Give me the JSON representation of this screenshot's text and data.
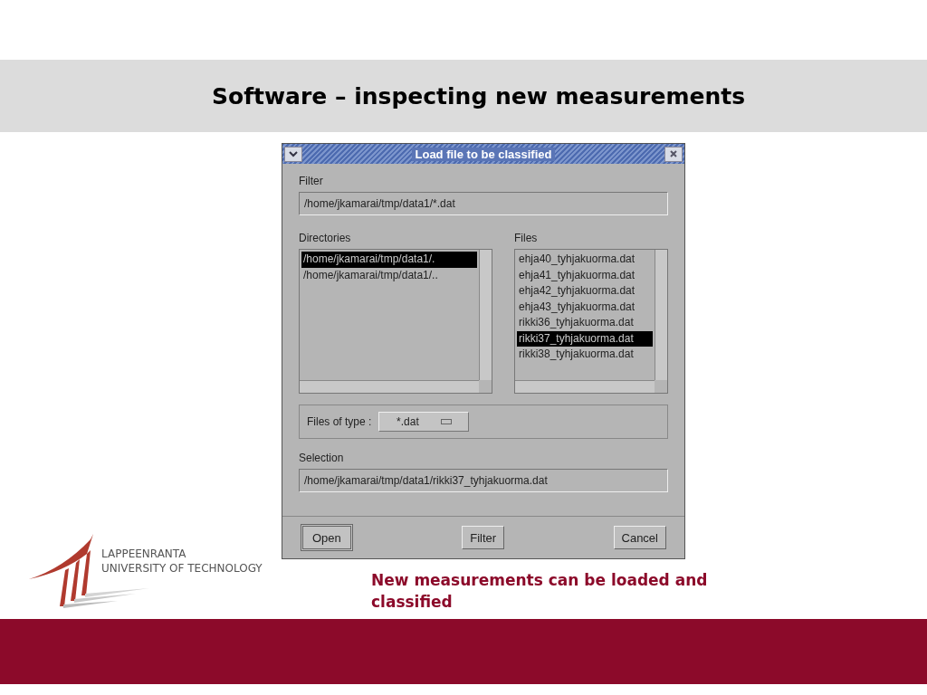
{
  "slide": {
    "title": "Software – inspecting new measurements",
    "caption": "New measurements can be loaded and classified"
  },
  "logo": {
    "lines": [
      "LAPPEENRANTA",
      "UNIVERSITY OF TECHNOLOGY"
    ]
  },
  "dialog": {
    "title": "Load file to be classified",
    "filter": {
      "label": "Filter",
      "value": "/home/jkamarai/tmp/data1/*.dat"
    },
    "directories": {
      "label": "Directories",
      "items": [
        {
          "label": "/home/jkamarai/tmp/data1/.",
          "selected": true
        },
        {
          "label": "/home/jkamarai/tmp/data1/..",
          "selected": false
        }
      ]
    },
    "files": {
      "label": "Files",
      "items": [
        {
          "label": "ehja40_tyhjakuorma.dat",
          "selected": false
        },
        {
          "label": "ehja41_tyhjakuorma.dat",
          "selected": false
        },
        {
          "label": "ehja42_tyhjakuorma.dat",
          "selected": false
        },
        {
          "label": "ehja43_tyhjakuorma.dat",
          "selected": false
        },
        {
          "label": "rikki36_tyhjakuorma.dat",
          "selected": false
        },
        {
          "label": "rikki37_tyhjakuorma.dat",
          "selected": true
        },
        {
          "label": "rikki38_tyhjakuorma.dat",
          "selected": false
        }
      ]
    },
    "file_type": {
      "label": "Files of type :",
      "value": "*.dat"
    },
    "selection": {
      "label": "Selection",
      "value": "/home/jkamarai/tmp/data1/rikki37_tyhjakuorma.dat"
    },
    "buttons": [
      {
        "label": "Open",
        "default": true
      },
      {
        "label": "Filter",
        "default": false
      },
      {
        "label": "Cancel",
        "default": false
      }
    ]
  }
}
